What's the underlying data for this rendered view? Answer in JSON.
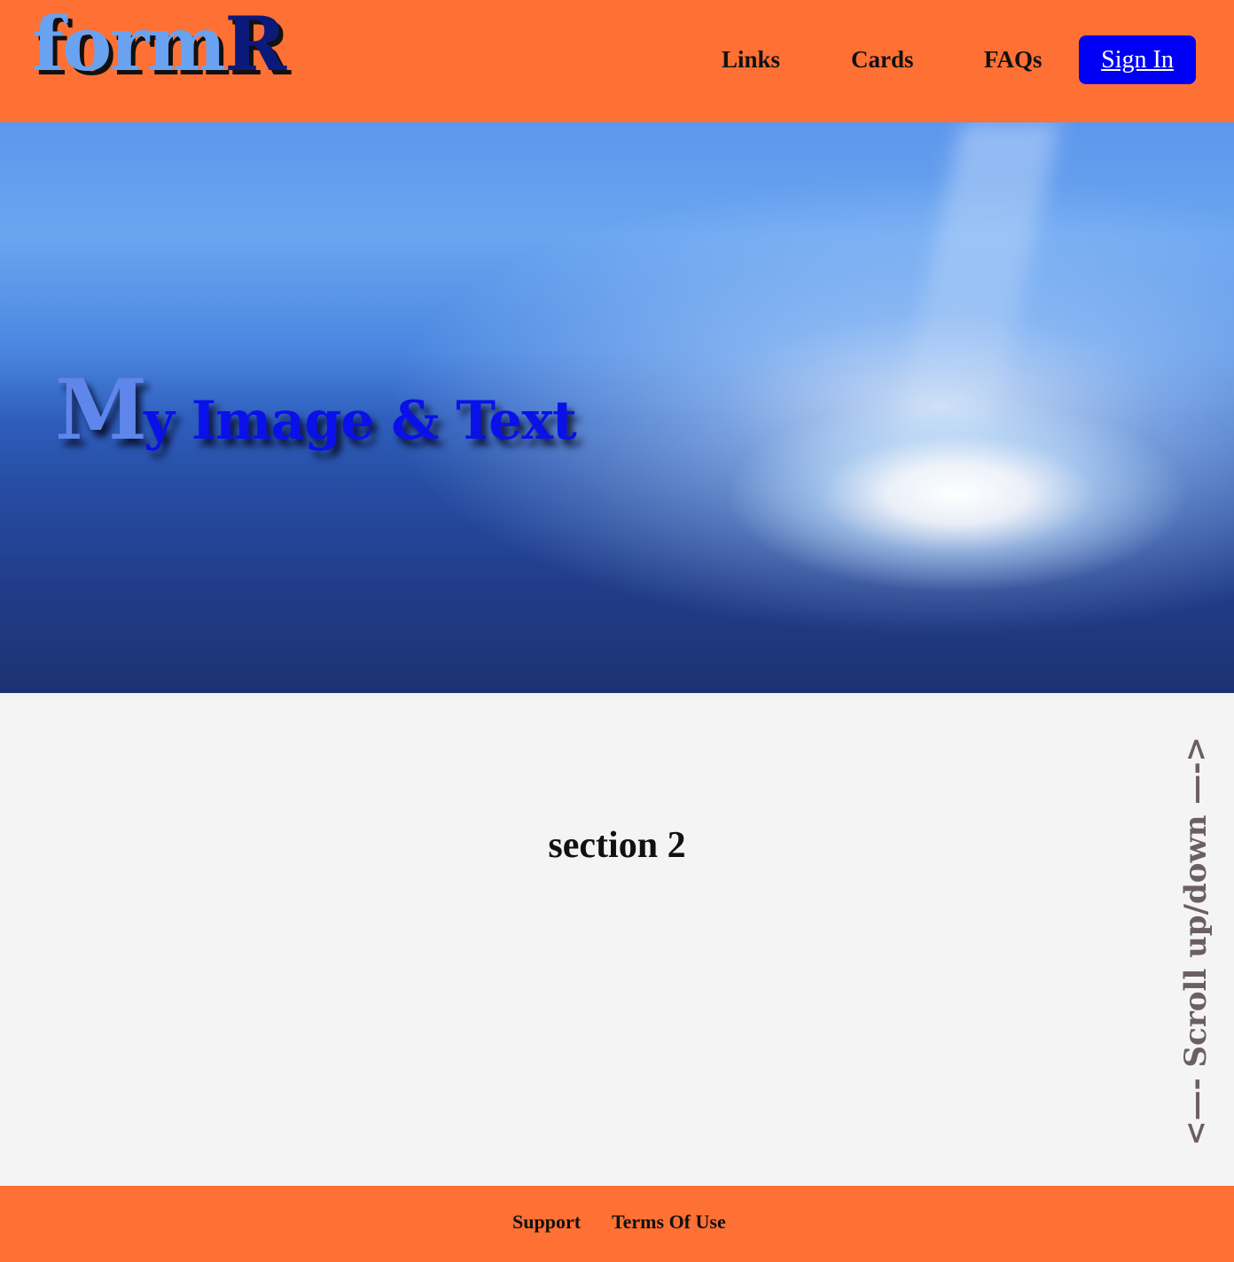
{
  "header": {
    "logo_part1": "form",
    "logo_part2": "R",
    "nav": {
      "links_label": "Links",
      "cards_label": "Cards",
      "faqs_label": "FAQs",
      "signin_label": "Sign In"
    }
  },
  "hero": {
    "title_first_letter": "M",
    "title_rest": "y Image & Text"
  },
  "section2": {
    "title": "section 2"
  },
  "scroll_hint": "<—- Scroll up/down —->",
  "footer": {
    "support_label": "Support",
    "terms_label": "Terms Of Use"
  },
  "colors": {
    "header_bg": "#ff7034",
    "signin_bg": "#0000f5",
    "logo_light_blue": "#6aa2f2",
    "logo_dark_blue": "#0b1a7a",
    "hero_title_blue": "#0a10ea",
    "scroll_hint": "#6b5f63",
    "section_bg": "#f4f4f4"
  }
}
